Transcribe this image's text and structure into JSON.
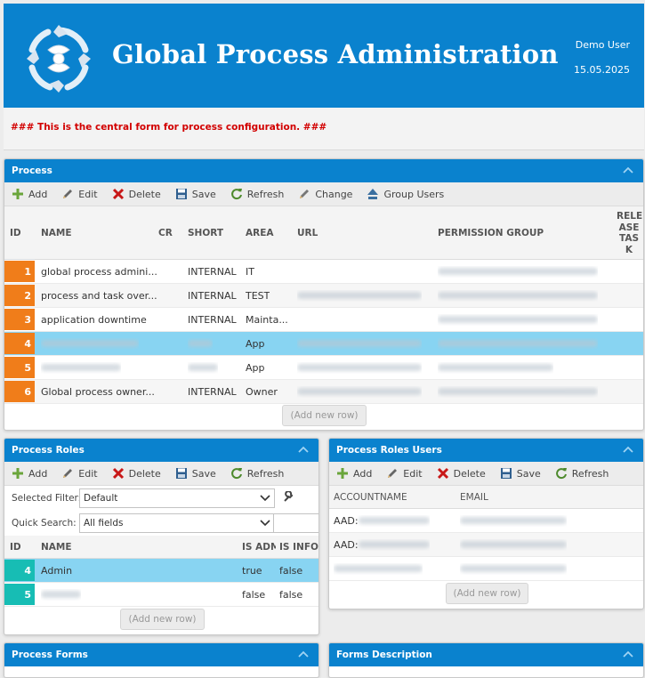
{
  "header": {
    "title": "Global Process Administration",
    "user": "Demo User",
    "date": "15.05.2025"
  },
  "banner": {
    "text": "### This is the central form for process configuration. ###"
  },
  "process": {
    "title": "Process",
    "toolbar": {
      "add": "Add",
      "edit": "Edit",
      "delete": "Delete",
      "save": "Save",
      "refresh": "Refresh",
      "change": "Change",
      "group_users": "Group Users"
    },
    "columns": {
      "id": "ID",
      "name": "NAME",
      "cr": "CR",
      "short": "SHORT",
      "area": "AREA",
      "url": "URL",
      "permission_group": "PERMISSION GROUP",
      "release_task": "RELE\nASE\nTAS\nK"
    },
    "rows": [
      {
        "id": "1",
        "name": "global process admini...",
        "short": "INTERNAL",
        "area": "IT"
      },
      {
        "id": "2",
        "name": "process and task over...",
        "short": "INTERNAL",
        "area": "TEST"
      },
      {
        "id": "3",
        "name": "application downtime",
        "short": "INTERNAL",
        "area": "Mainta..."
      },
      {
        "id": "4",
        "name": "",
        "short": "",
        "area": "App"
      },
      {
        "id": "5",
        "name": "",
        "short": "",
        "area": "App"
      },
      {
        "id": "6",
        "name": "Global process owner...",
        "short": "INTERNAL",
        "area": "Owner"
      }
    ],
    "add_new_row": "(Add new row)"
  },
  "process_roles": {
    "title": "Process Roles",
    "toolbar": {
      "add": "Add",
      "edit": "Edit",
      "delete": "Delete",
      "save": "Save",
      "refresh": "Refresh"
    },
    "selected_filter_label": "Selected Filter:",
    "selected_filter_value": "Default",
    "quick_search_label": "Quick Search:",
    "quick_search_value": "All fields",
    "columns": {
      "id": "ID",
      "name": "NAME",
      "is_admin": "IS ADM",
      "is_info": "IS INFO"
    },
    "rows": [
      {
        "id": "4",
        "name": "Admin",
        "is_admin": "true",
        "is_info": "false"
      },
      {
        "id": "5",
        "name": "",
        "is_admin": "false",
        "is_info": "false"
      }
    ],
    "add_new_row": "(Add new row)"
  },
  "process_roles_users": {
    "title": "Process Roles Users",
    "toolbar": {
      "add": "Add",
      "edit": "Edit",
      "delete": "Delete",
      "save": "Save",
      "refresh": "Refresh"
    },
    "columns": {
      "accountname": "ACCOUNTNAME",
      "email": "EMAIL"
    },
    "rows": [
      {
        "accountname": "AAD:"
      },
      {
        "accountname": "AAD:"
      },
      {
        "accountname": ""
      }
    ],
    "add_new_row": "(Add new row)"
  },
  "process_forms": {
    "title": "Process Forms"
  },
  "forms_description": {
    "title": "Forms Description"
  },
  "colors": {
    "brand": "#0a82ce",
    "orange": "#f07d1a",
    "teal": "#17bdb4",
    "selected": "#88d4f2",
    "warning_text": "#d20000"
  },
  "icons": [
    "logo-icon",
    "plus-icon",
    "pencil-icon",
    "x-icon",
    "floppy-icon",
    "refresh-icon",
    "change-icon",
    "group-users-icon",
    "chevron-up-icon",
    "chevron-down-icon",
    "wrench-icon"
  ]
}
